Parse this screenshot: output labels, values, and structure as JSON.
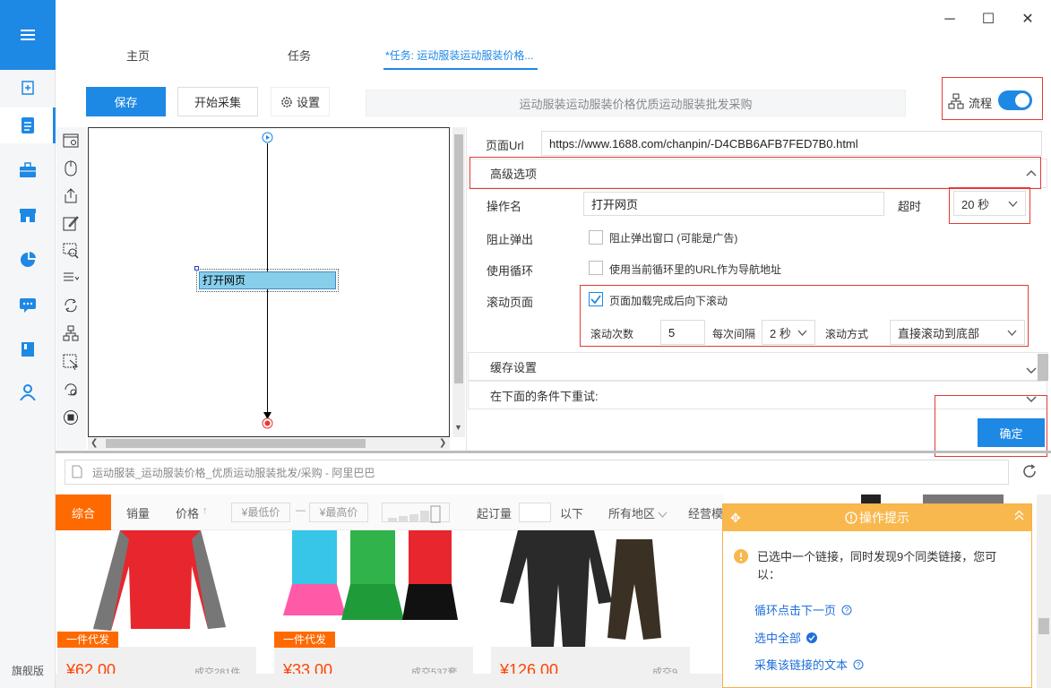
{
  "sidebar": {
    "footer": "旗舰版",
    "icons": [
      "menu-icon",
      "new-task-icon",
      "task-list-icon",
      "toolbox-icon",
      "store-icon",
      "chart-icon",
      "message-icon",
      "book-icon",
      "user-icon"
    ]
  },
  "tabs": [
    "主页",
    "任务",
    "*任务: 运动服装运动服装价格..."
  ],
  "window": {
    "minimize": "─",
    "maximize": "☐",
    "close": "✕"
  },
  "toolbar": {
    "save": "保存",
    "start": "开始采集",
    "settings": "设置",
    "title": "运动服装运动服装价格优质运动服装批发采购",
    "flow": "流程"
  },
  "flow_node": "打开网页",
  "panel": {
    "page_url_label": "页面Url",
    "page_url": "https://www.1688.com/chanpin/-D4CBB6AFB7FED7B0.html",
    "advanced": "高级选项",
    "op_name_label": "操作名",
    "op_name": "打开网页",
    "timeout_label": "超时",
    "timeout": "20 秒",
    "block_popup_label": "阻止弹出",
    "block_popup_text": "阻止弹出窗口 (可能是广告)",
    "loop_label": "使用循环",
    "loop_text": "使用当前循环里的URL作为导航地址",
    "scroll_label": "滚动页面",
    "scroll_text": "页面加载完成后向下滚动",
    "scroll_count_label": "滚动次数",
    "scroll_count": "5",
    "interval_label": "每次间隔",
    "interval": "2 秒",
    "scroll_mode_label": "滚动方式",
    "scroll_mode": "直接滚动到底部",
    "cache": "缓存设置",
    "retry": "在下面的条件下重试:",
    "confirm": "确定"
  },
  "browser": {
    "page_title": "运动服装_运动服装价格_优质运动服装批发/采购 - 阿里巴巴",
    "filters": {
      "all": "综合",
      "sales": "销量",
      "price": "价格",
      "min": "¥最低价",
      "dash": "—",
      "max": "¥最高价",
      "moq": "起订量",
      "below": "以下",
      "region": "所有地区",
      "mode": "经营模"
    },
    "products": [
      {
        "badge": "一件代发",
        "price": "¥62.00",
        "sold": "成交281件"
      },
      {
        "badge": "一件代发",
        "price": "¥33.00",
        "sold": "成交537套"
      },
      {
        "badge": "",
        "price": "¥126.00",
        "sold": "成交9"
      }
    ]
  },
  "tips": {
    "title": "操作提示",
    "message": "已选中一个链接，同时发现9个同类链接，您可以：",
    "actions": [
      "循环点击下一页",
      "选中全部",
      "采集该链接的文本"
    ]
  },
  "colors": {
    "accent": "#1e88e5",
    "warning": "#f9b84e",
    "highlight": "#e53935"
  }
}
